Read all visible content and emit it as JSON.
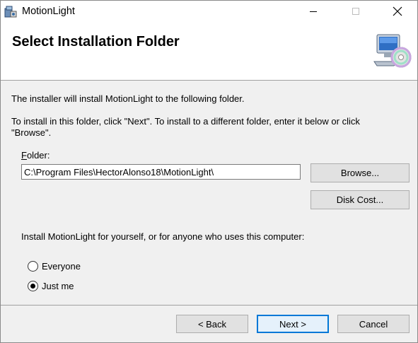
{
  "window": {
    "title": "MotionLight",
    "icon": "installer-icon"
  },
  "header": {
    "title": "Select Installation Folder",
    "graphic": "computer-disc-icon"
  },
  "body": {
    "intro": "The installer will install MotionLight to the following folder.",
    "instructions_line1": "To install in this folder, click \"Next\". To install to a different folder, enter it below or click",
    "instructions_line2": "\"Browse\".",
    "folder_label_mnemonic": "F",
    "folder_label_rest": "older:",
    "folder_value": "C:\\Program Files\\HectorAlonso18\\MotionLight\\",
    "browse_label": "Browse...",
    "disk_cost_label": "Disk Cost...",
    "install_for_prompt": "Install MotionLight for yourself, or for anyone who uses this computer:",
    "options": [
      {
        "label": "Everyone",
        "checked": false
      },
      {
        "label": "Just me",
        "checked": true
      }
    ]
  },
  "footer": {
    "back_label": "< Back",
    "next_label": "Next >",
    "cancel_label": "Cancel"
  }
}
